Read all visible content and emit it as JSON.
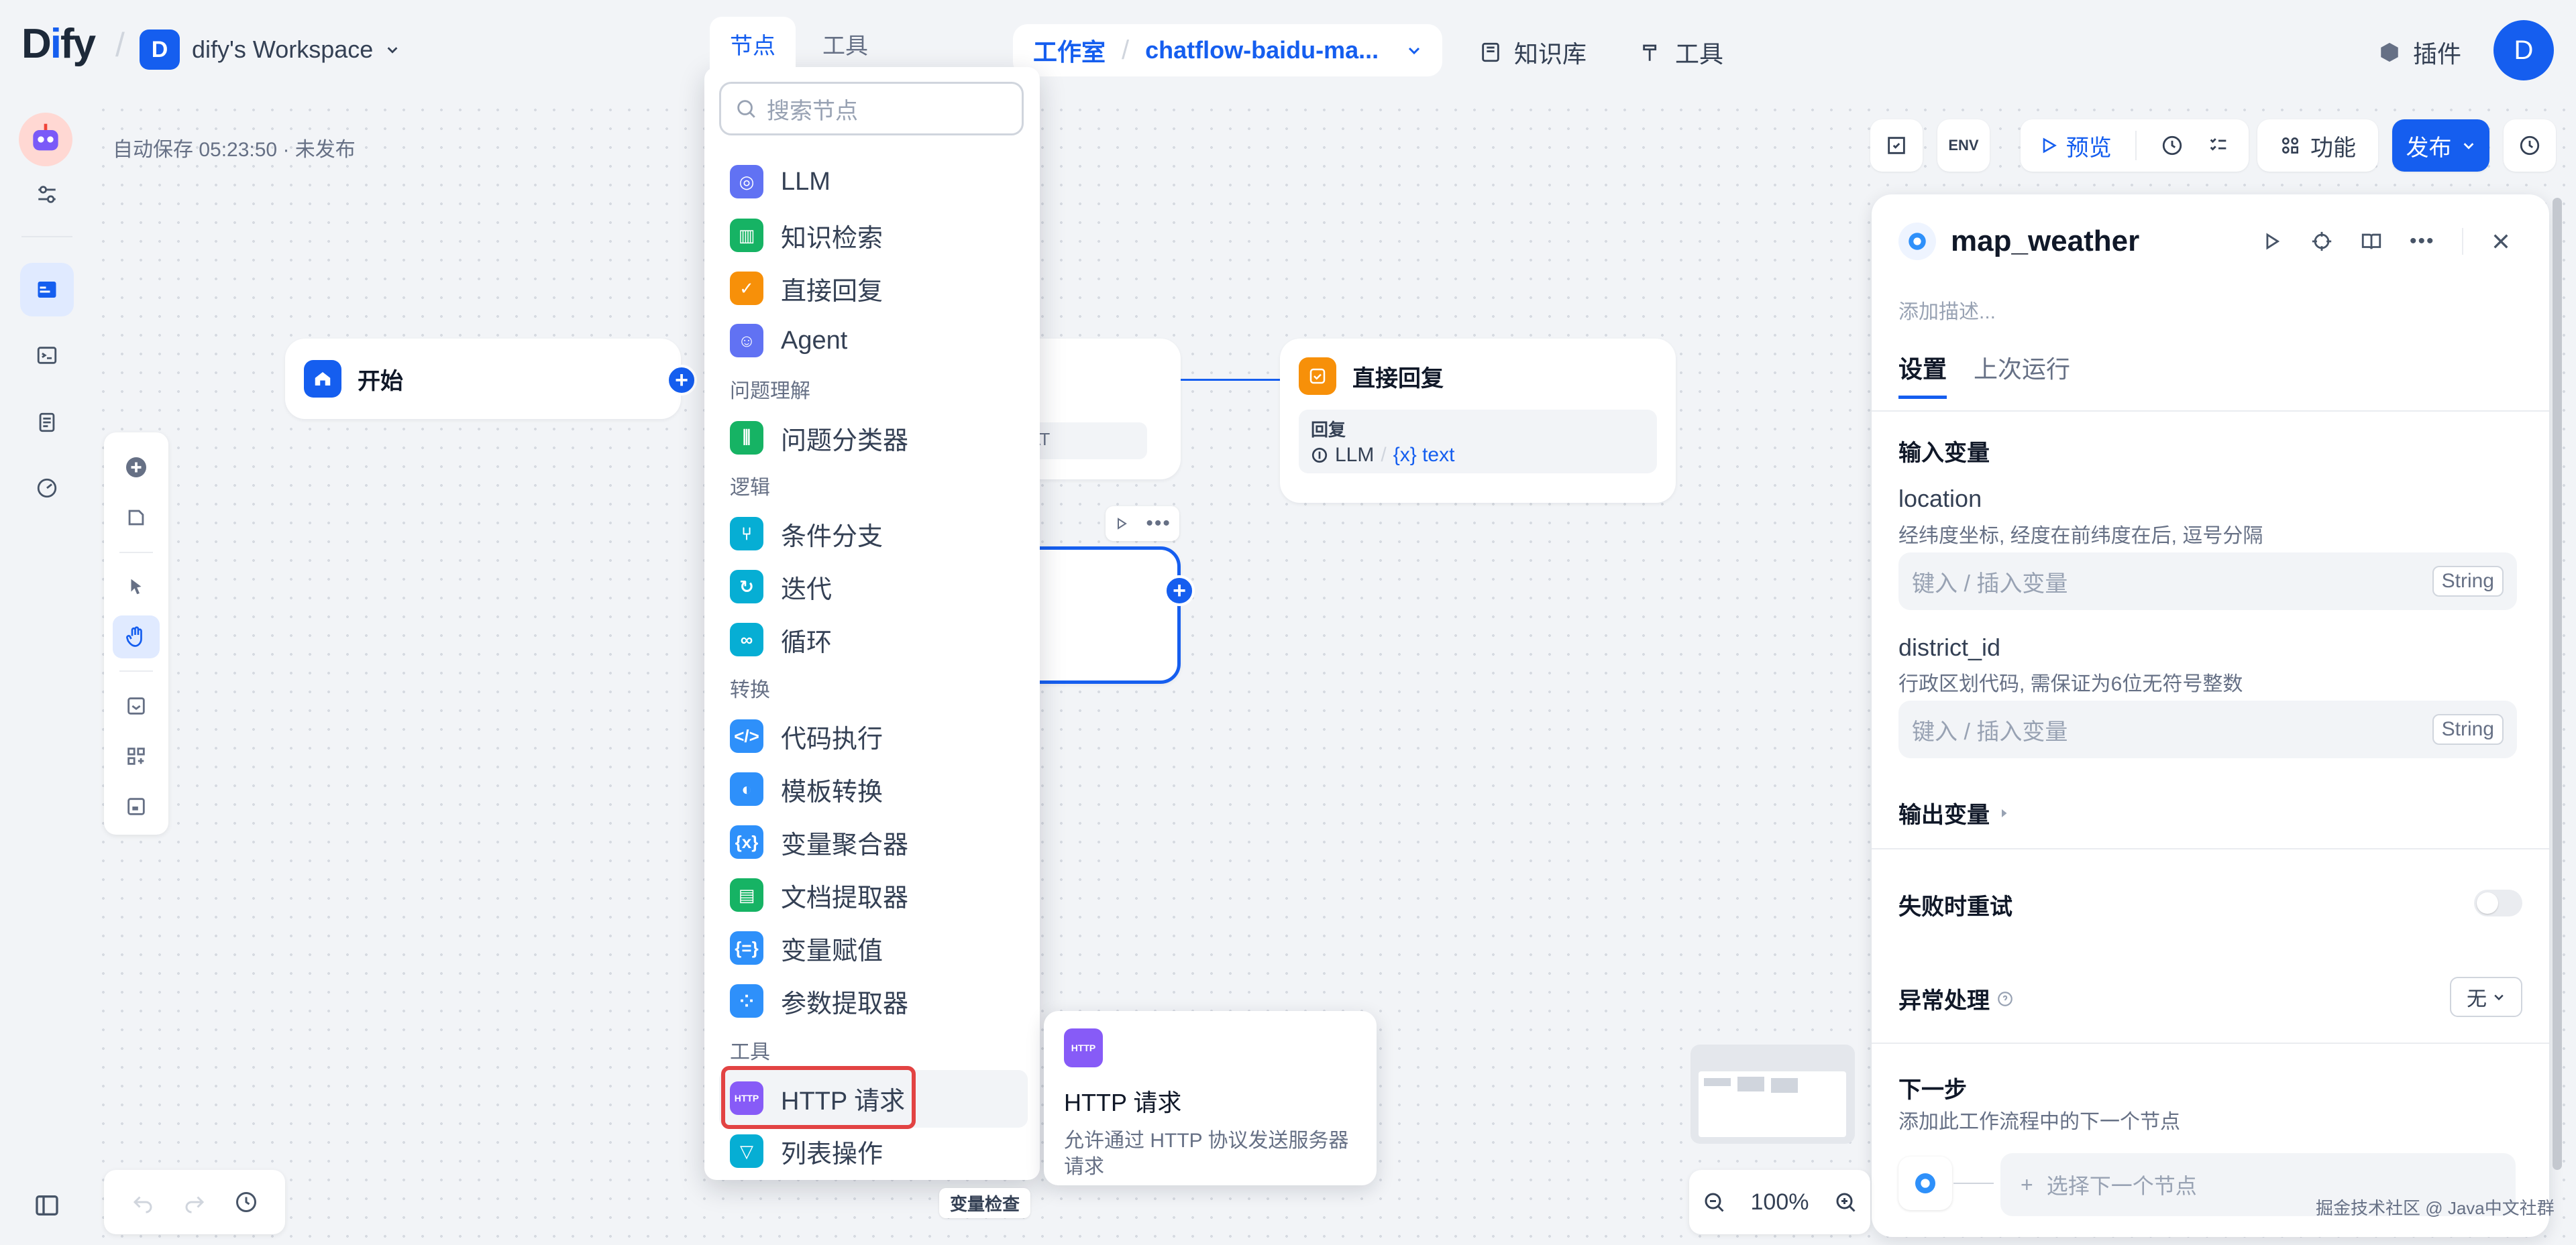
{
  "app": {
    "logo_prefix": "D",
    "logo_rest": "fy",
    "logo_i": "i"
  },
  "workspace": {
    "avatar": "D",
    "name": "dify's Workspace"
  },
  "breadcrumb": {
    "studio": "工作室",
    "app_name": "chatflow-baidu-ma..."
  },
  "topnav": {
    "knowledge": "知识库",
    "tools": "工具",
    "plugins": "插件",
    "user_avatar": "D"
  },
  "canvas": {
    "autosave": "自动保存 05:23:50 · 未发布"
  },
  "nodes": {
    "start": {
      "title": "开始"
    },
    "answer": {
      "title": "直接回复",
      "field_label": "回复",
      "ref_node": "LLM",
      "ref_var": "{x} text"
    },
    "llm_partial_badge": "AT"
  },
  "dropdown": {
    "tabs": {
      "nodes": "节点",
      "tools": "工具"
    },
    "search_placeholder": "搜索节点",
    "items_top": [
      {
        "label": "LLM",
        "color": "#6172f3"
      },
      {
        "label": "知识检索",
        "color": "#16b364"
      },
      {
        "label": "直接回复",
        "color": "#f79009"
      },
      {
        "label": "Agent",
        "color": "#6172f3"
      }
    ],
    "cat_qu": "问题理解",
    "item_classifier": {
      "label": "问题分类器",
      "color": "#16b364"
    },
    "cat_logic": "逻辑",
    "items_logic": [
      {
        "label": "条件分支",
        "color": "#06aed4"
      },
      {
        "label": "迭代",
        "color": "#06aed4"
      },
      {
        "label": "循环",
        "color": "#06aed4"
      }
    ],
    "cat_transform": "转换",
    "items_transform": [
      {
        "label": "代码执行",
        "color": "#2e90fa"
      },
      {
        "label": "模板转换",
        "color": "#2e90fa"
      },
      {
        "label": "变量聚合器",
        "color": "#2e90fa"
      },
      {
        "label": "文档提取器",
        "color": "#16b364"
      },
      {
        "label": "变量赋值",
        "color": "#2e90fa"
      },
      {
        "label": "参数提取器",
        "color": "#2e90fa"
      }
    ],
    "cat_tools": "工具",
    "item_http": {
      "label": "HTTP 请求",
      "color": "#875bf7",
      "icon_text": "HTTP"
    },
    "item_list": {
      "label": "列表操作",
      "color": "#06aed4"
    }
  },
  "tooltip": {
    "icon_text": "HTTP",
    "title": "HTTP 请求",
    "desc": "允许通过 HTTP 协议发送服务器请求"
  },
  "toolbar_right": {
    "env": "ENV",
    "preview": "预览",
    "features": "功能",
    "publish": "发布"
  },
  "panel": {
    "title": "map_weather",
    "desc_placeholder": "添加描述...",
    "tabs": {
      "settings": "设置",
      "last_run": "上次运行"
    },
    "input_vars_label": "输入变量",
    "vars": [
      {
        "name": "location",
        "desc": "经纬度坐标, 经度在前纬度在后, 逗号分隔",
        "placeholder": "键入 / 插入变量",
        "type": "String"
      },
      {
        "name": "district_id",
        "desc": "行政区划代码, 需保证为6位无符号整数",
        "placeholder": "键入 / 插入变量",
        "type": "String"
      }
    ],
    "output_vars_label": "输出变量",
    "retry_label": "失败时重试",
    "error_label": "异常处理",
    "error_value": "无",
    "next_label": "下一步",
    "next_desc": "添加此工作流程中的下一个节点",
    "next_placeholder": "选择下一个节点"
  },
  "zoom": {
    "level": "100%"
  },
  "varcheck": "变量检查",
  "watermark": "掘金技术社区 @ Java中文社群",
  "colors": {
    "accent": "#155eef",
    "highlight_border": "#e24343"
  }
}
